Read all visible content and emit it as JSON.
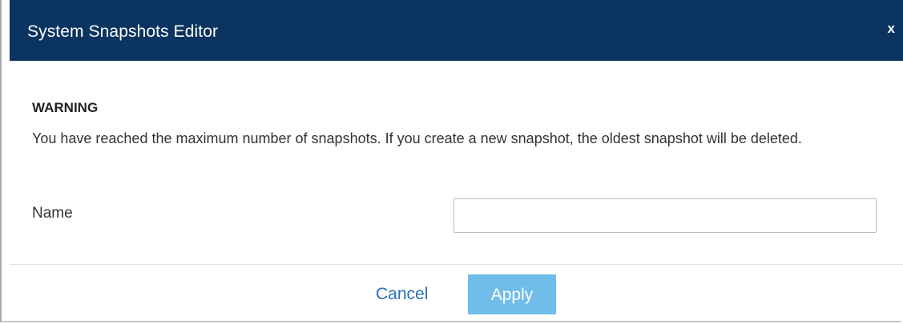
{
  "dialog": {
    "title": "System Snapshots Editor",
    "close_label": "x"
  },
  "warning": {
    "title": "WARNING",
    "message": "You have reached the maximum number of snapshots. If you create a new snapshot, the oldest snapshot will be deleted."
  },
  "form": {
    "name_label": "Name",
    "name_value": ""
  },
  "footer": {
    "cancel_label": "Cancel",
    "apply_label": "Apply"
  },
  "colors": {
    "titlebar": "#0b3460",
    "apply_button": "#6fbde8",
    "cancel_link": "#2c6fb7"
  }
}
